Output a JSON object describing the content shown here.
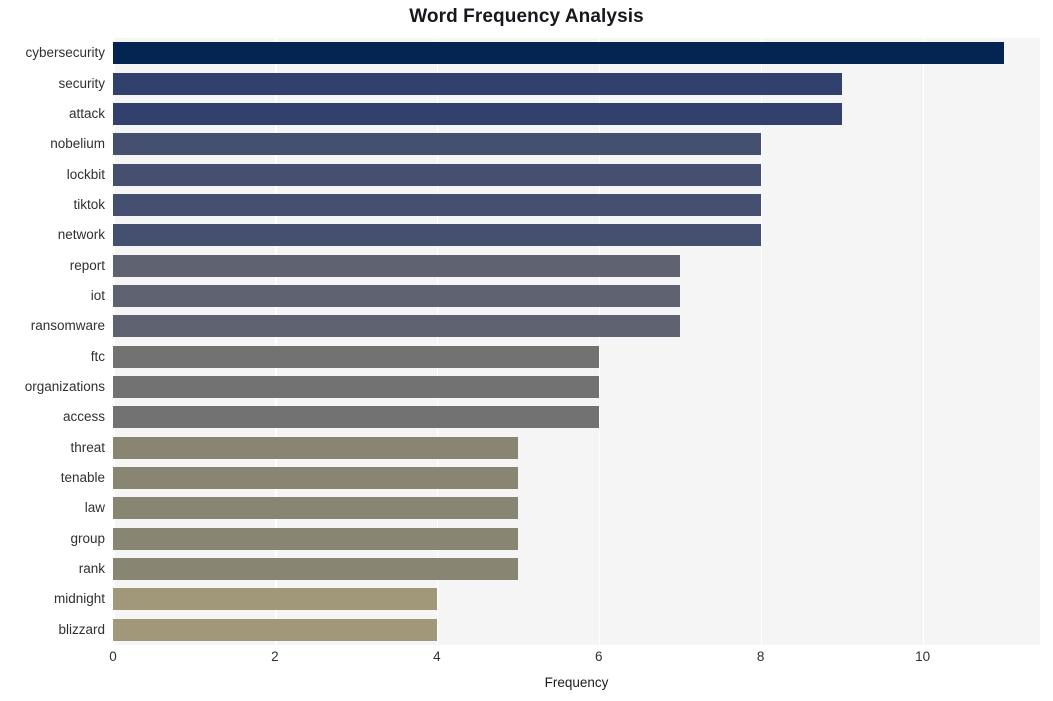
{
  "chart_data": {
    "type": "bar",
    "orientation": "horizontal",
    "title": "Word Frequency Analysis",
    "xlabel": "Frequency",
    "ylabel": "",
    "categories": [
      "cybersecurity",
      "security",
      "attack",
      "nobelium",
      "lockbit",
      "tiktok",
      "network",
      "report",
      "iot",
      "ransomware",
      "ftc",
      "organizations",
      "access",
      "threat",
      "tenable",
      "law",
      "group",
      "rank",
      "midnight",
      "blizzard"
    ],
    "values": [
      11,
      9,
      9,
      8,
      8,
      8,
      8,
      7,
      7,
      7,
      6,
      6,
      6,
      5,
      5,
      5,
      5,
      5,
      4,
      4
    ],
    "bar_colors": [
      "#042451",
      "#31406c",
      "#31406c",
      "#454f6f",
      "#454f6f",
      "#454f6f",
      "#454f6f",
      "#5e6271",
      "#5e6271",
      "#5e6271",
      "#727272",
      "#727272",
      "#727272",
      "#888672",
      "#888672",
      "#888672",
      "#888672",
      "#888672",
      "#a09878",
      "#a09878"
    ],
    "xlim": [
      0,
      11.45
    ],
    "xticks": [
      0,
      2,
      4,
      6,
      8,
      10
    ],
    "xtick_labels": [
      "0",
      "2",
      "4",
      "6",
      "8",
      "10"
    ],
    "grid": "vertical",
    "grid_color": "#ffffff",
    "plot_background": "#f5f5f6",
    "figure_background": "#ffffff",
    "legend": null
  }
}
